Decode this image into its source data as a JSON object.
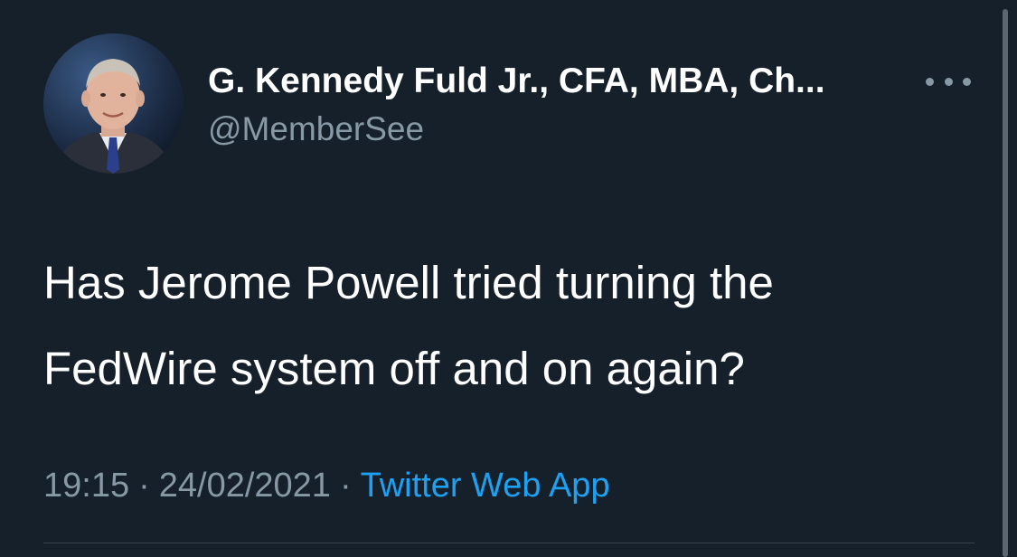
{
  "tweet": {
    "author": {
      "display_name": "G. Kennedy Fuld Jr., CFA, MBA, Ch...",
      "handle": "@MemberSee",
      "avatar_icon": "profile-photo"
    },
    "text_lines": [
      "Has Jerome Powell tried turning the",
      "FedWire system off and on again?"
    ],
    "time": "19:15",
    "date": "24/02/2021",
    "separator": "·",
    "source": "Twitter Web App",
    "more_icon": "more-horizontal-icon"
  },
  "colors": {
    "background": "#15202b",
    "primary_text": "#ffffff",
    "secondary_text": "#8899a6",
    "link": "#1da1f2",
    "divider": "#38444d"
  }
}
